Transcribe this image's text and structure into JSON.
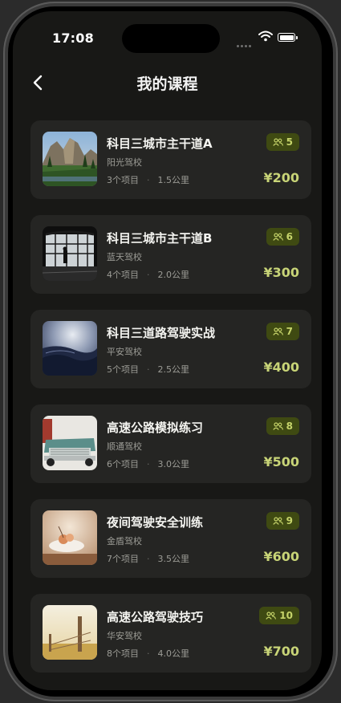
{
  "status": {
    "time": "17:08"
  },
  "header": {
    "title": "我的课程",
    "back_icon": "chevron-left-icon"
  },
  "courses": [
    {
      "title": "科目三城市主干道A",
      "school": "阳光驾校",
      "items": "3个项目",
      "distance": "1.5公里",
      "students": "5",
      "price": "¥200",
      "image": "mountain-valley-photo"
    },
    {
      "title": "科目三城市主干道B",
      "school": "蓝天驾校",
      "items": "4个项目",
      "distance": "2.0公里",
      "students": "6",
      "price": "¥300",
      "image": "window-silhouette-photo"
    },
    {
      "title": "科目三道路驾驶实战",
      "school": "平安驾校",
      "items": "5个项目",
      "distance": "2.5公里",
      "students": "7",
      "price": "¥400",
      "image": "ocean-wave-photo"
    },
    {
      "title": "高速公路模拟练习",
      "school": "顺通驾校",
      "items": "6个项目",
      "distance": "3.0公里",
      "students": "8",
      "price": "¥500",
      "image": "vintage-car-photo"
    },
    {
      "title": "夜间驾驶安全训练",
      "school": "金盾驾校",
      "items": "7个项目",
      "distance": "3.5公里",
      "students": "9",
      "price": "¥600",
      "image": "flower-still-life-photo"
    },
    {
      "title": "高速公路驾驶技巧",
      "school": "华安驾校",
      "items": "8个项目",
      "distance": "4.0公里",
      "students": "10",
      "price": "¥700",
      "image": "fence-post-photo"
    }
  ],
  "colors": {
    "accent": "#c8d477",
    "badge_bg": "#3f4a12",
    "card_bg": "#252523",
    "screen_bg": "#181816"
  }
}
